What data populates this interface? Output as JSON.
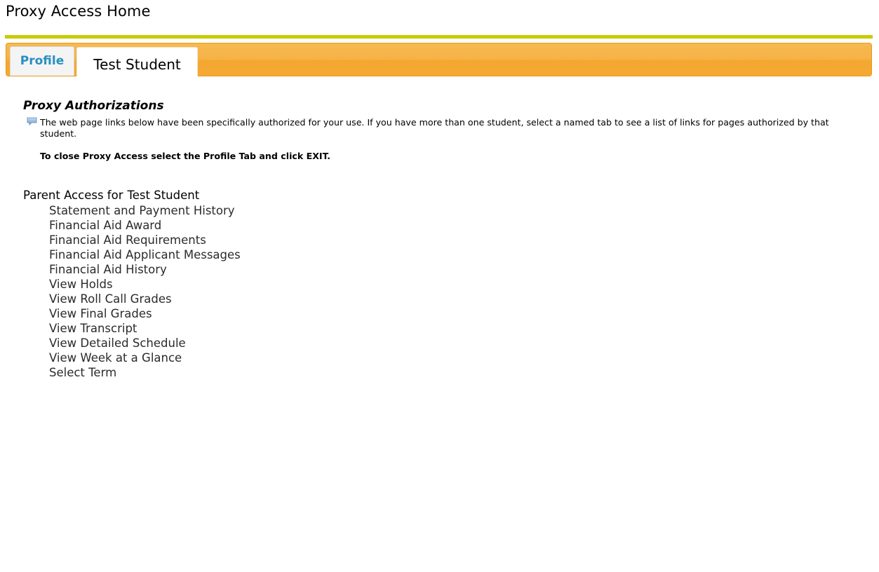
{
  "page": {
    "title": "Proxy Access Home"
  },
  "tabs": [
    {
      "label": "Profile",
      "active": false
    },
    {
      "label": "Test Student",
      "active": true
    }
  ],
  "colors": {
    "title_rule": "#c8cc00",
    "tabbar": "#f5b247",
    "tab_profile_text": "#2a8fc0",
    "link_text": "#2b2b2b"
  },
  "authorizations": {
    "heading": "Proxy Authorizations",
    "info_icon": "speech-bubble-icon",
    "info_text": "The web page links below have been specifically authorized for your use. If you have more than one student, select a named tab to see a list of links for pages authorized by that student.",
    "close_note": "To close Proxy Access select the Profile Tab and click EXIT."
  },
  "access": {
    "prefix": "Parent Access for",
    "student": "Test Student",
    "links": [
      "Statement and Payment History",
      "Financial Aid Award",
      "Financial Aid Requirements",
      "Financial Aid Applicant Messages",
      "Financial Aid History",
      "View Holds",
      "View Roll Call Grades",
      "View Final Grades",
      "View Transcript",
      "View Detailed Schedule",
      "View Week at a Glance",
      "Select Term"
    ]
  }
}
